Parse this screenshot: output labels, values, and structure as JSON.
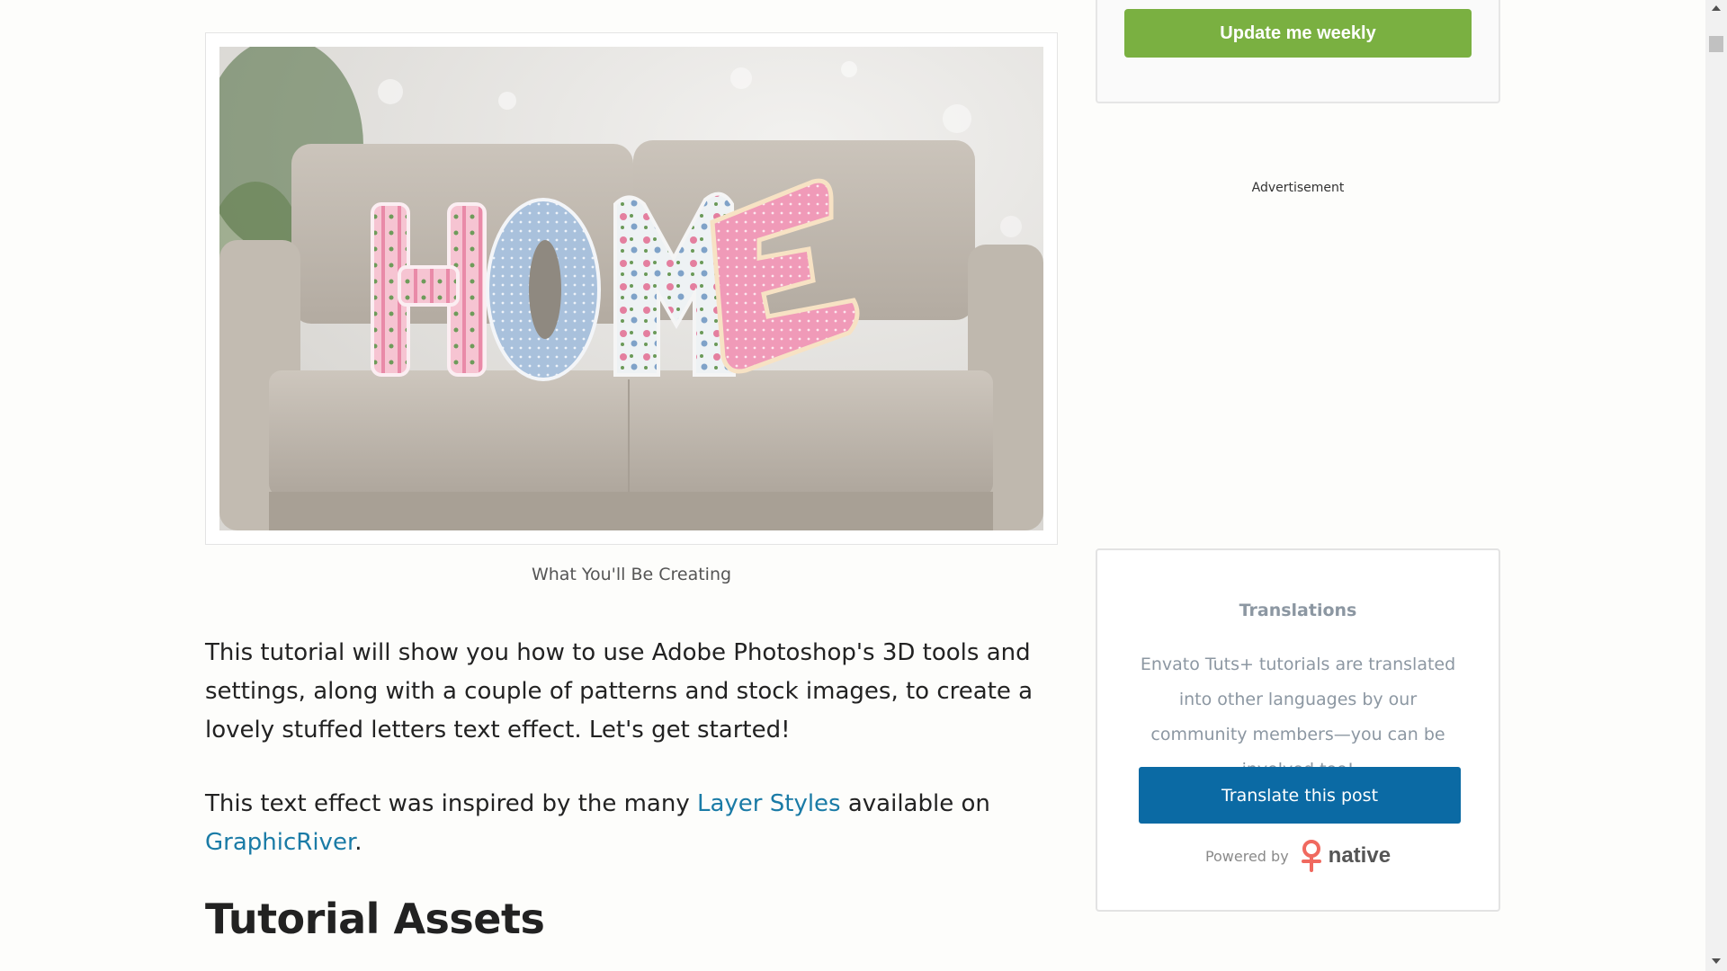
{
  "article": {
    "image_alt": "HOME stuffed letters on a sofa",
    "image_letters": [
      "H",
      "O",
      "M",
      "E"
    ],
    "caption": "What You'll Be Creating",
    "para1": "This tutorial will show you how to use Adobe Photoshop's 3D tools and settings, along with a couple of patterns and stock images, to create a lovely stuffed letters text effect. Let's get started!",
    "para2": {
      "before": "This text effect was inspired by the many ",
      "link1": "Layer Styles",
      "middle": " available on ",
      "link2": "GraphicRiver",
      "after": "."
    },
    "heading": "Tutorial Assets"
  },
  "sidebar": {
    "newsletter_button": "Update me weekly",
    "ad_label": "Advertisement",
    "translations": {
      "title": "Translations",
      "text": "Envato Tuts+ tutorials are translated into other languages by our community members—you can be involved too!",
      "button": "Translate this post",
      "powered_by": "Powered by",
      "brand": "native"
    }
  },
  "colors": {
    "green_button": "#7ab041",
    "blue_button": "#0b6aa4",
    "link": "#1a7ba6"
  },
  "icons": {
    "native_logo": "native-logo-icon",
    "scroll_up": "scroll-up-arrow-icon",
    "scroll_down": "scroll-down-arrow-icon"
  }
}
